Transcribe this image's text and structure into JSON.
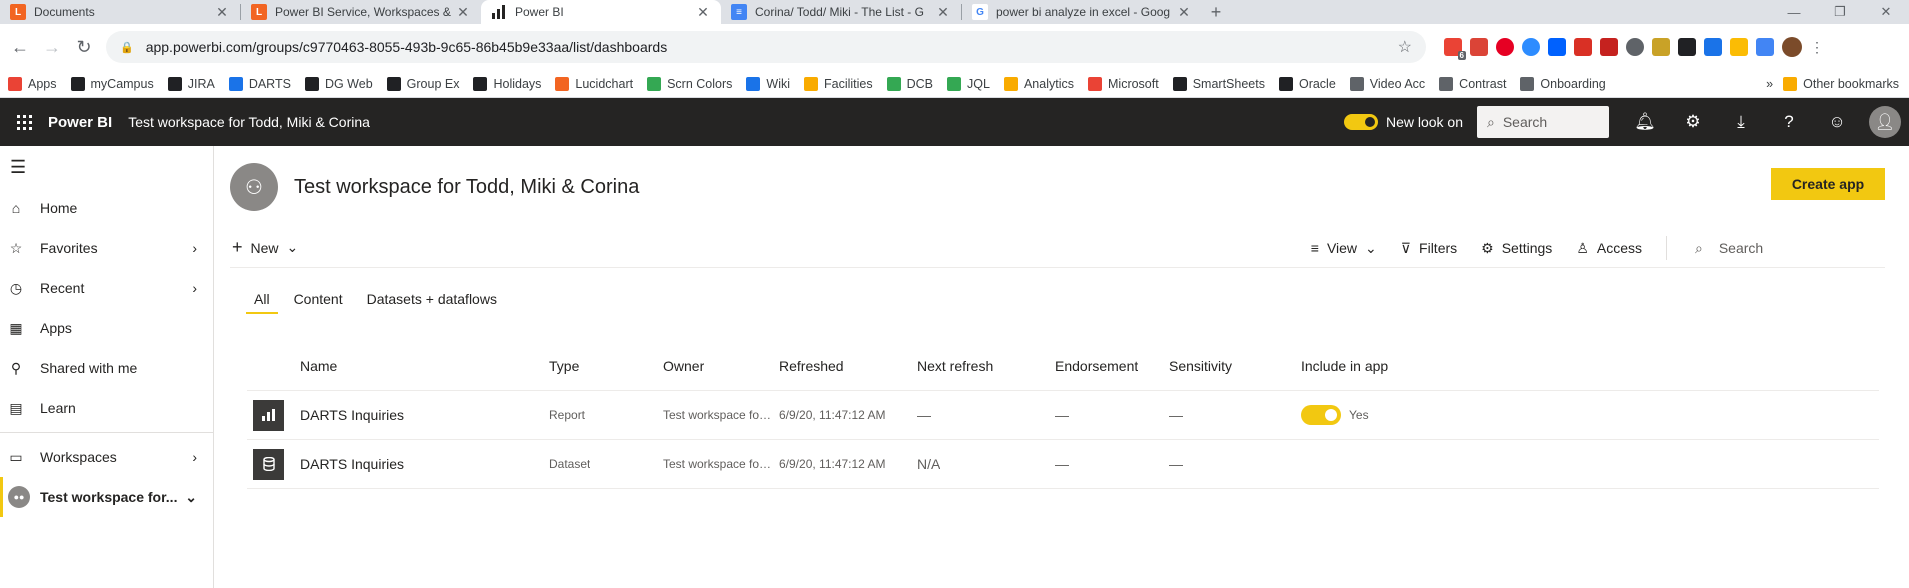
{
  "browser": {
    "tabs": [
      {
        "title": "Documents",
        "icon_color": "#f26522",
        "icon_glyph": "L",
        "active": false
      },
      {
        "title": "Power BI Service, Workspaces & ",
        "icon_color": "#f26522",
        "icon_glyph": "L",
        "active": false
      },
      {
        "title": "Power BI",
        "icon_color": "#252423",
        "icon_glyph": "bar-chart",
        "active": true
      },
      {
        "title": "Corina/ Todd/ Miki - The List - G",
        "icon_color": "#4285f4",
        "icon_glyph": "doc",
        "active": false
      },
      {
        "title": "power bi analyze in excel - Goog",
        "icon_color": "#ffffff",
        "icon_glyph": "G",
        "active": false
      }
    ],
    "url": "app.powerbi.com/groups/c9770463-8055-493b-9c65-86b45b9e33aa/list/dashboards",
    "extension_badge": "6",
    "bookmarks": [
      {
        "label": "Apps",
        "color": "#ea4335"
      },
      {
        "label": "myCampus",
        "color": "#202124"
      },
      {
        "label": "JIRA",
        "color": "#202124"
      },
      {
        "label": "DARTS",
        "color": "#1a73e8"
      },
      {
        "label": "DG Web",
        "color": "#202124"
      },
      {
        "label": "Group Ex",
        "color": "#202124"
      },
      {
        "label": "Holidays",
        "color": "#202124"
      },
      {
        "label": "Lucidchart",
        "color": "#f26522"
      },
      {
        "label": "Scrn Colors",
        "color": "#34a853"
      },
      {
        "label": "Wiki",
        "color": "#1a73e8"
      },
      {
        "label": "Facilities",
        "color": "#f9ab00"
      },
      {
        "label": "DCB",
        "color": "#34a853"
      },
      {
        "label": "JQL",
        "color": "#34a853"
      },
      {
        "label": "Analytics",
        "color": "#f9ab00"
      },
      {
        "label": "Microsoft",
        "color": "#ea4335"
      },
      {
        "label": "SmartSheets",
        "color": "#202124"
      },
      {
        "label": "Oracle",
        "color": "#202124"
      },
      {
        "label": "Video Acc",
        "color": "#5f6368"
      },
      {
        "label": "Contrast",
        "color": "#5f6368"
      },
      {
        "label": "Onboarding",
        "color": "#5f6368"
      }
    ],
    "more_bookmarks": "»",
    "other_bookmarks": "Other bookmarks"
  },
  "header": {
    "brand": "Power BI",
    "workspace": "Test workspace for Todd, Miki & Corina",
    "new_look_label": "New look on",
    "search_placeholder": "Search"
  },
  "sidebar": {
    "items": [
      {
        "label": "Home",
        "icon": "home-icon",
        "has_chevron": false
      },
      {
        "label": "Favorites",
        "icon": "star-icon",
        "has_chevron": true
      },
      {
        "label": "Recent",
        "icon": "clock-icon",
        "has_chevron": true
      },
      {
        "label": "Apps",
        "icon": "apps-icon",
        "has_chevron": false
      },
      {
        "label": "Shared with me",
        "icon": "shared-icon",
        "has_chevron": false
      },
      {
        "label": "Learn",
        "icon": "learn-icon",
        "has_chevron": false
      }
    ],
    "workspaces_label": "Workspaces",
    "active_workspace_label": "Test workspace for..."
  },
  "workspace": {
    "title": "Test workspace for Todd, Miki & Corina",
    "create_app_label": "Create app"
  },
  "commandbar": {
    "new_label": "New",
    "view_label": "View",
    "filters_label": "Filters",
    "settings_label": "Settings",
    "access_label": "Access",
    "search_placeholder": "Search"
  },
  "content_tabs": [
    {
      "label": "All",
      "active": true
    },
    {
      "label": "Content",
      "active": false
    },
    {
      "label": "Datasets + dataflows",
      "active": false
    }
  ],
  "table": {
    "columns": [
      "Name",
      "Type",
      "Owner",
      "Refreshed",
      "Next refresh",
      "Endorsement",
      "Sensitivity",
      "Include in app"
    ],
    "rows": [
      {
        "icon": "report-icon",
        "name": "DARTS Inquiries",
        "type": "Report",
        "owner": "Test workspace for To...",
        "refreshed": "6/9/20, 11:47:12 AM",
        "next_refresh": "—",
        "endorsement": "—",
        "sensitivity": "—",
        "include_in_app": "Yes",
        "include_toggle": true
      },
      {
        "icon": "dataset-icon",
        "name": "DARTS Inquiries",
        "type": "Dataset",
        "owner": "Test workspace for To...",
        "refreshed": "6/9/20, 11:47:12 AM",
        "next_refresh": "N/A",
        "endorsement": "—",
        "sensitivity": "—",
        "include_in_app": "",
        "include_toggle": false
      }
    ]
  }
}
